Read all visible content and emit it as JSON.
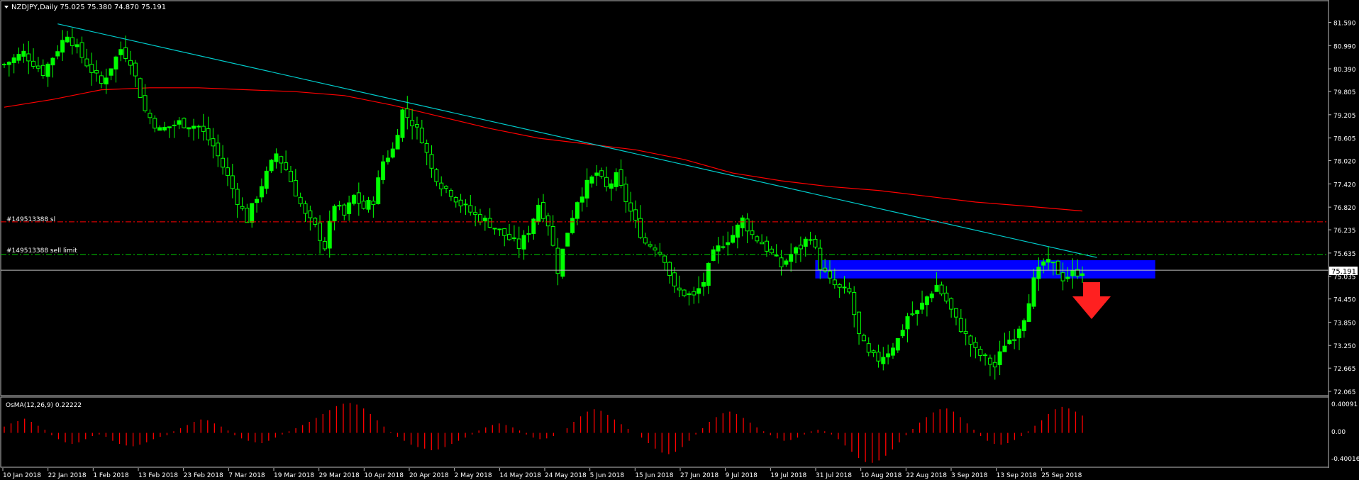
{
  "title": "NZDJPY,Daily  75.025 75.380 74.870 75.191",
  "colors": {
    "background": "#000000",
    "bull": "#00ff00",
    "bear_fill": "#000000",
    "ma": "#ff0000",
    "trendline": "#00cccc",
    "zone": "#0000ff",
    "osma": "#ff0000",
    "sl_line": "#ff0000",
    "sell_line": "#00cc00",
    "arrow": "#ff2020"
  },
  "orders": {
    "sl_label": "#149513388 sl",
    "sl_value": 76.44,
    "sell_label": "#149513388 sell limit",
    "sell_value": 75.6
  },
  "current_price": {
    "value": 75.191,
    "label": "75.191"
  },
  "osma": {
    "label": "OsMA(12,26,9) 0.22222",
    "ticks": [
      "0.40091",
      "0.00",
      "-0.40016"
    ],
    "ylim": [
      -0.40016,
      0.40091
    ]
  },
  "chart_data": {
    "type": "candlestick",
    "title": "NZDJPY,Daily",
    "ylim": [
      72.065,
      81.8
    ],
    "yticks": [
      "81.590",
      "80.990",
      "80.390",
      "79.805",
      "79.205",
      "78.605",
      "78.020",
      "77.420",
      "76.820",
      "76.235",
      "75.635",
      "75.035",
      "74.450",
      "73.850",
      "73.250",
      "72.665",
      "72.065"
    ],
    "xticks": [
      "10 Jan 2018",
      "22 Jan 2018",
      "1 Feb 2018",
      "13 Feb 2018",
      "23 Feb 2018",
      "7 Mar 2018",
      "19 Mar 2018",
      "29 Mar 2018",
      "10 Apr 2018",
      "20 Apr 2018",
      "2 May 2018",
      "14 May 2018",
      "24 May 2018",
      "5 Jun 2018",
      "15 Jun 2018",
      "27 Jun 2018",
      "9 Jul 2018",
      "19 Jul 2018",
      "31 Jul 2018",
      "10 Aug 2018",
      "22 Aug 2018",
      "3 Sep 2018",
      "13 Sep 2018",
      "25 Sep 2018"
    ],
    "close_path": [
      [
        0,
        80.5
      ],
      [
        4,
        80.8
      ],
      [
        8,
        80.3
      ],
      [
        12,
        81.1
      ],
      [
        13,
        81.3
      ],
      [
        16,
        80.7
      ],
      [
        20,
        80.0
      ],
      [
        24,
        80.9
      ],
      [
        26,
        80.6
      ],
      [
        29,
        79.3
      ],
      [
        32,
        78.8
      ],
      [
        36,
        79.0
      ],
      [
        40,
        78.9
      ],
      [
        43,
        78.4
      ],
      [
        46,
        77.6
      ],
      [
        48,
        77.0
      ],
      [
        50,
        76.5
      ],
      [
        53,
        77.4
      ],
      [
        56,
        78.2
      ],
      [
        58,
        77.8
      ],
      [
        60,
        77.2
      ],
      [
        62,
        76.6
      ],
      [
        64,
        76.3
      ],
      [
        66,
        75.8
      ],
      [
        68,
        76.9
      ],
      [
        70,
        76.6
      ],
      [
        72,
        77.1
      ],
      [
        74,
        76.8
      ],
      [
        76,
        77.0
      ],
      [
        78,
        78.0
      ],
      [
        80,
        78.3
      ],
      [
        82,
        79.3
      ],
      [
        84,
        79.0
      ],
      [
        86,
        78.6
      ],
      [
        88,
        77.8
      ],
      [
        90,
        77.4
      ],
      [
        92,
        77.2
      ],
      [
        94,
        76.9
      ],
      [
        97,
        76.6
      ],
      [
        100,
        76.4
      ],
      [
        103,
        76.1
      ],
      [
        106,
        75.8
      ],
      [
        108,
        76.2
      ],
      [
        110,
        76.9
      ],
      [
        112,
        76.4
      ],
      [
        114,
        75.2
      ],
      [
        116,
        76.2
      ],
      [
        118,
        77.0
      ],
      [
        120,
        77.4
      ],
      [
        122,
        77.7
      ],
      [
        124,
        77.3
      ],
      [
        126,
        77.6
      ],
      [
        128,
        77.0
      ],
      [
        130,
        76.4
      ],
      [
        132,
        75.9
      ],
      [
        134,
        75.8
      ],
      [
        136,
        75.5
      ],
      [
        138,
        74.7
      ],
      [
        140,
        74.6
      ],
      [
        142,
        74.5
      ],
      [
        144,
        74.9
      ],
      [
        146,
        75.6
      ],
      [
        148,
        75.9
      ],
      [
        150,
        76.1
      ],
      [
        152,
        76.5
      ],
      [
        154,
        76.1
      ],
      [
        156,
        75.9
      ],
      [
        158,
        75.6
      ],
      [
        160,
        75.3
      ],
      [
        162,
        75.6
      ],
      [
        164,
        75.8
      ],
      [
        166,
        76.1
      ],
      [
        168,
        75.3
      ],
      [
        170,
        74.9
      ],
      [
        172,
        74.7
      ],
      [
        174,
        74.6
      ],
      [
        176,
        73.5
      ],
      [
        178,
        73.0
      ],
      [
        180,
        72.9
      ],
      [
        182,
        73.1
      ],
      [
        184,
        73.4
      ],
      [
        186,
        74.0
      ],
      [
        188,
        74.1
      ],
      [
        190,
        74.5
      ],
      [
        192,
        74.8
      ],
      [
        194,
        74.4
      ],
      [
        196,
        73.9
      ],
      [
        198,
        73.5
      ],
      [
        200,
        73.1
      ],
      [
        202,
        72.9
      ],
      [
        204,
        72.7
      ],
      [
        206,
        73.3
      ],
      [
        208,
        73.5
      ],
      [
        210,
        74.0
      ],
      [
        212,
        74.9
      ],
      [
        214,
        75.4
      ],
      [
        216,
        75.3
      ],
      [
        218,
        75.0
      ],
      [
        220,
        75.1
      ],
      [
        222,
        75.19
      ]
    ],
    "ma_path": [
      [
        0,
        79.4
      ],
      [
        10,
        79.6
      ],
      [
        20,
        79.85
      ],
      [
        30,
        79.9
      ],
      [
        40,
        79.9
      ],
      [
        50,
        79.85
      ],
      [
        60,
        79.8
      ],
      [
        70,
        79.7
      ],
      [
        80,
        79.45
      ],
      [
        90,
        79.15
      ],
      [
        100,
        78.85
      ],
      [
        110,
        78.6
      ],
      [
        120,
        78.45
      ],
      [
        130,
        78.3
      ],
      [
        140,
        78.05
      ],
      [
        150,
        77.7
      ],
      [
        160,
        77.5
      ],
      [
        170,
        77.35
      ],
      [
        180,
        77.25
      ],
      [
        190,
        77.1
      ],
      [
        200,
        76.95
      ],
      [
        210,
        76.85
      ],
      [
        222,
        76.72
      ]
    ],
    "trendline": {
      "start": [
        11,
        81.55
      ],
      "end": [
        225,
        75.52
      ]
    },
    "resistance_zone": {
      "from_index": 167,
      "to_index": 237,
      "low": 74.98,
      "high": 75.45
    },
    "osma_values": [
      0.08,
      0.12,
      0.15,
      0.18,
      0.14,
      0.09,
      0.04,
      -0.03,
      -0.08,
      -0.12,
      -0.14,
      -0.12,
      -0.08,
      -0.04,
      -0.02,
      -0.05,
      -0.1,
      -0.14,
      -0.16,
      -0.17,
      -0.15,
      -0.12,
      -0.08,
      -0.05,
      -0.03,
      0.02,
      0.06,
      0.1,
      0.14,
      0.17,
      0.16,
      0.12,
      0.08,
      0.03,
      -0.03,
      -0.07,
      -0.1,
      -0.12,
      -0.13,
      -0.1,
      -0.06,
      -0.02,
      0.02,
      0.06,
      0.1,
      0.14,
      0.19,
      0.24,
      0.29,
      0.34,
      0.37,
      0.38,
      0.36,
      0.31,
      0.24,
      0.16,
      0.08,
      0.01,
      -0.05,
      -0.1,
      -0.15,
      -0.18,
      -0.2,
      -0.22,
      -0.21,
      -0.18,
      -0.14,
      -0.1,
      -0.06,
      -0.02,
      0.03,
      0.07,
      0.1,
      0.12,
      0.1,
      0.07,
      0.03,
      -0.02,
      -0.06,
      -0.08,
      -0.07,
      -0.04,
      0.0,
      0.06,
      0.14,
      0.21,
      0.27,
      0.3,
      0.28,
      0.23,
      0.17,
      0.11,
      0.05,
      0.0,
      -0.06,
      -0.13,
      -0.2,
      -0.25,
      -0.27,
      -0.24,
      -0.18,
      -0.1,
      -0.02,
      0.06,
      0.14,
      0.2,
      0.25,
      0.27,
      0.24,
      0.19,
      0.13,
      0.07,
      0.02,
      -0.03,
      -0.07,
      -0.1,
      -0.09,
      -0.06,
      -0.02,
      0.02,
      0.04,
      0.02,
      -0.02,
      -0.08,
      -0.16,
      -0.24,
      -0.32,
      -0.37,
      -0.38,
      -0.35,
      -0.29,
      -0.21,
      -0.12,
      -0.03,
      0.05,
      0.13,
      0.2,
      0.26,
      0.3,
      0.31,
      0.27,
      0.2,
      0.12,
      0.04,
      -0.04,
      -0.1,
      -0.14,
      -0.15,
      -0.13,
      -0.09,
      -0.04,
      0.02,
      0.09,
      0.16,
      0.24,
      0.3,
      0.33,
      0.31,
      0.27,
      0.22
    ]
  }
}
